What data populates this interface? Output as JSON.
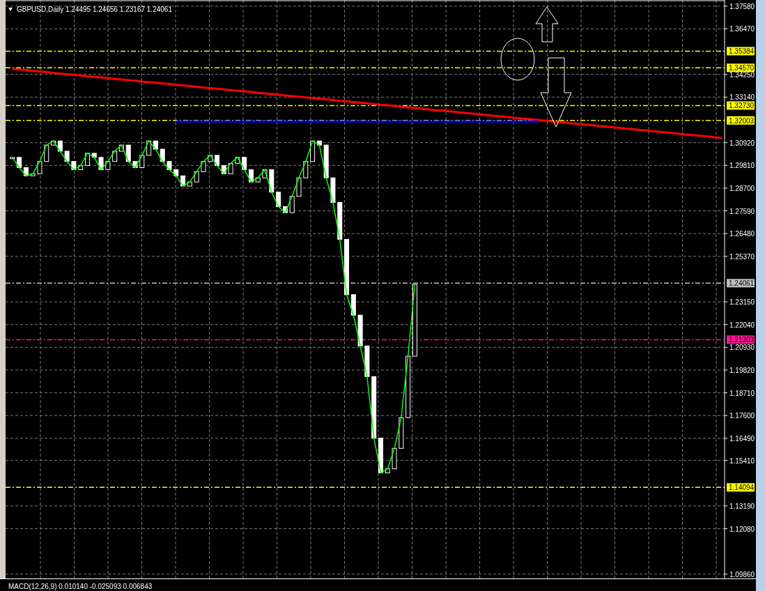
{
  "chart": {
    "title": "GBPUSD,Daily 1.24495 1.24656 1.23167 1.24061",
    "chart_data": {
      "type": "line",
      "ylim": [
        1.0965,
        1.3788
      ],
      "grid": true,
      "yticks": [
        {
          "value": 1.3758,
          "label": "1.37580"
        },
        {
          "value": 1.3647,
          "label": "1.36470"
        },
        {
          "value": 1.3425,
          "label": "1.34250"
        },
        {
          "value": 1.3314,
          "label": "1.33140"
        },
        {
          "value": 1.3092,
          "label": "1.30920"
        },
        {
          "value": 1.2981,
          "label": "1.29810"
        },
        {
          "value": 1.287,
          "label": "1.28700"
        },
        {
          "value": 1.2759,
          "label": "1.27590"
        },
        {
          "value": 1.2648,
          "label": "1.26480"
        },
        {
          "value": 1.2537,
          "label": "1.25370"
        },
        {
          "value": 1.2315,
          "label": "1.23150"
        },
        {
          "value": 1.2204,
          "label": "1.22040"
        },
        {
          "value": 1.2093,
          "label": "1.20930"
        },
        {
          "value": 1.1982,
          "label": "1.19820"
        },
        {
          "value": 1.1871,
          "label": "1.18710"
        },
        {
          "value": 1.176,
          "label": "1.17600"
        },
        {
          "value": 1.1649,
          "label": "1.16490"
        },
        {
          "value": 1.1541,
          "label": "1.15410"
        },
        {
          "value": 1.1319,
          "label": "1.13190"
        },
        {
          "value": 1.1208,
          "label": "1.12080"
        },
        {
          "value": 1.0986,
          "label": "1.09860"
        }
      ],
      "series": [
        {
          "color": "#00ff00",
          "values": [
            1.302,
            1.297,
            1.293,
            1.294,
            1.3,
            1.308,
            1.31,
            1.305,
            1.3,
            1.296,
            1.298,
            1.304,
            1.302,
            1.296,
            1.3,
            1.305,
            1.308,
            1.3,
            1.297,
            1.303,
            1.31,
            1.306,
            1.3,
            1.296,
            1.293,
            1.288,
            1.29,
            1.295,
            1.3,
            1.303,
            1.298,
            1.294,
            1.299,
            1.302,
            1.296,
            1.29,
            1.292,
            1.296,
            1.285,
            1.278,
            1.275,
            1.283,
            1.292,
            1.3,
            1.31,
            1.308,
            1.292,
            1.28,
            1.262,
            1.235,
            1.225,
            1.21,
            1.195,
            1.165,
            1.148,
            1.15,
            1.16,
            1.175,
            1.205,
            1.24
          ]
        },
        {
          "color": "#ff0000",
          "values": [
            1.3452,
            1.3449,
            1.3446,
            1.3442,
            1.3439,
            1.3436,
            1.3433,
            1.3429,
            1.3426,
            1.3423,
            1.342,
            1.3416,
            1.3413,
            1.341,
            1.3407,
            1.3403,
            1.34,
            1.3397,
            1.3394,
            1.339,
            1.3387,
            1.3384,
            1.3381,
            1.3378,
            1.3374,
            1.3371,
            1.3368,
            1.3365,
            1.3361,
            1.3358,
            1.3355,
            1.3352,
            1.3348,
            1.3345,
            1.3342,
            1.3339,
            1.3335,
            1.3332,
            1.3329,
            1.3326,
            1.3322,
            1.3319,
            1.3316,
            1.3313,
            1.3309,
            1.3306,
            1.3303,
            1.33,
            1.3296,
            1.3293,
            1.329,
            1.3287,
            1.3284,
            1.328,
            1.3277,
            1.3274,
            1.3271,
            1.3267,
            1.3264,
            1.3261,
            1.3258,
            1.3254,
            1.3251,
            1.3248,
            1.3245,
            1.3241,
            1.3238,
            1.3235,
            1.3232,
            1.3228,
            1.3225,
            1.3222,
            1.3219,
            1.3216,
            1.3212,
            1.3209,
            1.3206,
            1.3203,
            1.3199,
            1.3196,
            1.3193,
            1.319,
            1.3186,
            1.3183,
            1.318,
            1.3177,
            1.3173,
            1.317,
            1.3167,
            1.3164,
            1.316,
            1.3157,
            1.3154,
            1.3151,
            1.3147,
            1.3144,
            1.3141,
            1.3138,
            1.3134,
            1.3131,
            1.3128,
            1.3125,
            1.3122,
            1.3118,
            1.3115
          ]
        },
        {
          "color": "#0000ff",
          "values": [
            null,
            null,
            null,
            null,
            null,
            null,
            null,
            null,
            null,
            null,
            null,
            null,
            null,
            null,
            null,
            null,
            null,
            null,
            null,
            null,
            null,
            null,
            null,
            null,
            1.3195,
            1.3195,
            1.3195,
            1.3195,
            1.3195,
            1.3195,
            1.3195,
            1.3195,
            1.3195,
            1.3195,
            1.3195,
            1.3195,
            1.3195,
            1.3195,
            1.3195,
            1.3195,
            1.3195,
            1.3195,
            1.3195,
            1.3195,
            1.3195,
            1.3195,
            1.3195,
            1.3195,
            1.3195,
            1.3195,
            1.3195,
            1.3195,
            1.3195,
            1.3195,
            1.3195,
            1.3195,
            1.3195,
            1.3195,
            1.3195,
            1.3195,
            1.3195,
            1.3195,
            1.3195,
            1.3195,
            1.3195,
            1.3195,
            1.3195,
            1.3195,
            1.3195,
            1.3195,
            1.3195,
            1.3195,
            1.3195,
            1.3195,
            1.3195,
            1.3195,
            1.3195,
            1.3195,
            null,
            null,
            null,
            null,
            null,
            null,
            null,
            null,
            null,
            null,
            null,
            null,
            null,
            null,
            null,
            null,
            null,
            null,
            null,
            null,
            null,
            null,
            null,
            null,
            null,
            null,
            null
          ]
        }
      ],
      "ref_lines": [
        {
          "axis": "y",
          "value": 1.35384,
          "label": "1.35384",
          "color": "#ffff00"
        },
        {
          "axis": "y",
          "value": 1.3457,
          "label": "1.34570",
          "color": "#ffff00"
        },
        {
          "axis": "y",
          "value": 1.3273,
          "label": "1.32730",
          "color": "#ffff00"
        },
        {
          "axis": "y",
          "value": 1.32003,
          "label": "1.32003",
          "color": "#ffff00"
        },
        {
          "axis": "y",
          "value": 1.24061,
          "label": "1.24061",
          "color": "#c0c0c0"
        },
        {
          "axis": "y",
          "value": 1.21303,
          "label": "1.21303",
          "color": "#ff1493"
        },
        {
          "axis": "y",
          "value": 1.14094,
          "label": "1.14094",
          "color": "#ffff00"
        }
      ]
    }
  },
  "indicator": {
    "title": "MACD(12,26,9) 0.010140 -0.025093 0.006843"
  }
}
